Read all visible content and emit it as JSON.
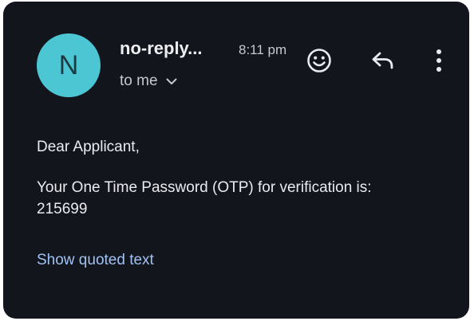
{
  "email": {
    "avatar_letter": "N",
    "sender": "no-reply...",
    "time": "8:11 pm",
    "recipient": "to me",
    "greeting": "Dear Applicant,",
    "message_line1": "Your One Time Password (OTP) for verification is:",
    "otp_code": "215699",
    "show_quoted_label": "Show quoted text"
  },
  "icons": {
    "emoji": "add-reaction-icon",
    "reply": "reply-icon",
    "more": "more-vertical-icon",
    "recipient_toggle": "chevron-down-icon"
  },
  "colors": {
    "background": "#13151c",
    "avatar": "#4dc6d4",
    "text": "#e9ebf0",
    "secondary_text": "#c5c8cf",
    "link": "#9fc2f3"
  }
}
